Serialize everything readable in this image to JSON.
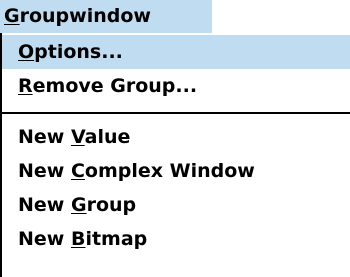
{
  "menu": {
    "title": {
      "pre": "",
      "mnemonic": "G",
      "post": "roupwindow"
    },
    "items": [
      {
        "pre": "",
        "mnemonic": "O",
        "post": "ptions...",
        "highlighted": true
      },
      {
        "pre": "",
        "mnemonic": "R",
        "post": "emove Group...",
        "highlighted": false
      }
    ],
    "items_after_separator": [
      {
        "pre": "New ",
        "mnemonic": "V",
        "post": "alue"
      },
      {
        "pre": "New ",
        "mnemonic": "C",
        "post": "omplex Window"
      },
      {
        "pre": "New ",
        "mnemonic": "G",
        "post": "roup"
      },
      {
        "pre": "New ",
        "mnemonic": "B",
        "post": "itmap"
      }
    ],
    "highlight_color": "#c0dcf0"
  }
}
